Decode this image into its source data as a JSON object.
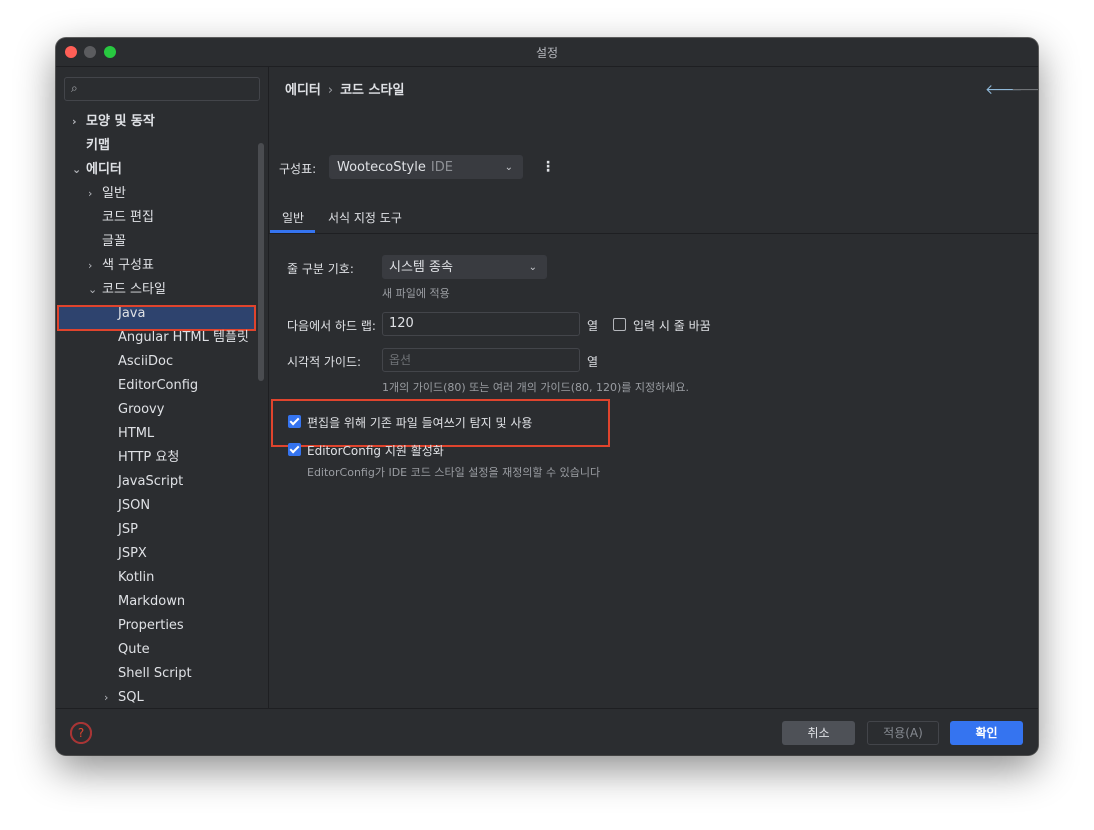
{
  "window": {
    "title": "설정"
  },
  "sidebar": {
    "search_placeholder": "",
    "items": [
      {
        "label": "모양 및 동작",
        "chevron": "›",
        "indent": 0,
        "bold": true
      },
      {
        "label": "키맵",
        "chevron": "",
        "indent": 0,
        "bold": true
      },
      {
        "label": "에디터",
        "chevron": "⌄",
        "indent": 0,
        "bold": true
      },
      {
        "label": "일반",
        "chevron": "›",
        "indent": 1
      },
      {
        "label": "코드 편집",
        "chevron": "",
        "indent": 1
      },
      {
        "label": "글꼴",
        "chevron": "",
        "indent": 1
      },
      {
        "label": "색 구성표",
        "chevron": "›",
        "indent": 1
      },
      {
        "label": "코드 스타일",
        "chevron": "⌄",
        "indent": 1,
        "selected": true
      },
      {
        "label": "Java",
        "chevron": "",
        "indent": 2
      },
      {
        "label": "Angular HTML 템플릿",
        "chevron": "",
        "indent": 2
      },
      {
        "label": "AsciiDoc",
        "chevron": "",
        "indent": 2
      },
      {
        "label": "EditorConfig",
        "chevron": "",
        "indent": 2
      },
      {
        "label": "Groovy",
        "chevron": "",
        "indent": 2
      },
      {
        "label": "HTML",
        "chevron": "",
        "indent": 2
      },
      {
        "label": "HTTP 요청",
        "chevron": "",
        "indent": 2
      },
      {
        "label": "JavaScript",
        "chevron": "",
        "indent": 2
      },
      {
        "label": "JSON",
        "chevron": "",
        "indent": 2
      },
      {
        "label": "JSP",
        "chevron": "",
        "indent": 2
      },
      {
        "label": "JSPX",
        "chevron": "",
        "indent": 2
      },
      {
        "label": "Kotlin",
        "chevron": "",
        "indent": 2
      },
      {
        "label": "Markdown",
        "chevron": "",
        "indent": 2
      },
      {
        "label": "Properties",
        "chevron": "",
        "indent": 2
      },
      {
        "label": "Qute",
        "chevron": "",
        "indent": 2
      },
      {
        "label": "Shell Script",
        "chevron": "",
        "indent": 2
      },
      {
        "label": "SQL",
        "chevron": "›",
        "indent": 2
      }
    ]
  },
  "main": {
    "breadcrumb": {
      "part1": "에디터",
      "sep": "›",
      "part2": "코드 스타일"
    },
    "scheme": {
      "label": "구성표:",
      "value": "WootecoStyle",
      "sub": "IDE"
    },
    "tabs": [
      {
        "label": "일반"
      },
      {
        "label": "서식 지정 도구"
      }
    ],
    "line_separator": {
      "label": "줄 구분 기호:",
      "value": "시스템 종속",
      "hint": "새 파일에 적용"
    },
    "hard_wrap": {
      "label": "다음에서 하드 랩:",
      "value": "120",
      "unit": "열",
      "checkbox_label": "입력 시 줄 바꿈",
      "checked": false
    },
    "visual_guides": {
      "label": "시각적 가이드:",
      "placeholder": "옵션",
      "unit": "열",
      "hint": "1개의 가이드(80) 또는 여러 개의 가이드(80, 120)를 지정하세요."
    },
    "detect_indent": {
      "label": "편집을 위해 기존 파일 들여쓰기 탐지 및 사용",
      "checked": true
    },
    "editorconfig": {
      "label": "EditorConfig 지원 활성화",
      "checked": true,
      "hint": "EditorConfig가 IDE 코드 스타일 설정을 재정의할 수 있습니다"
    }
  },
  "footer": {
    "help": "?",
    "cancel": "취소",
    "apply": "적용(A)",
    "ok": "확인"
  },
  "colors": {
    "accent": "#3574f0",
    "highlight": "#e0442d",
    "background": "#2b2d30"
  }
}
